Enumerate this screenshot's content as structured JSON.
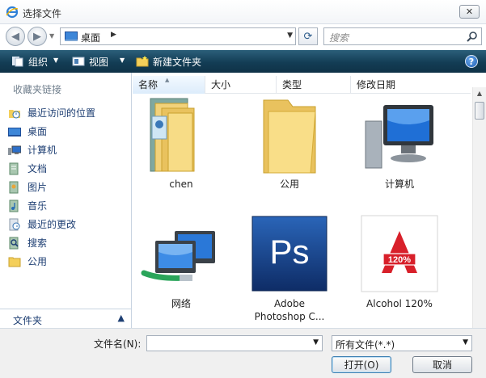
{
  "window": {
    "title": "选择文件"
  },
  "address": {
    "location": "桌面"
  },
  "search": {
    "placeholder": "搜索"
  },
  "toolbar": {
    "organize": "组织",
    "view": "视图",
    "new_folder": "新建文件夹"
  },
  "sidebar": {
    "heading": "收藏夹链接",
    "items": [
      {
        "label": "最近访问的位置",
        "icon": "recent-places-icon"
      },
      {
        "label": "桌面",
        "icon": "desktop-icon"
      },
      {
        "label": "计算机",
        "icon": "computer-icon"
      },
      {
        "label": "文档",
        "icon": "documents-icon"
      },
      {
        "label": "图片",
        "icon": "pictures-icon"
      },
      {
        "label": "音乐",
        "icon": "music-icon"
      },
      {
        "label": "最近的更改",
        "icon": "recent-changes-icon"
      },
      {
        "label": "搜索",
        "icon": "searches-icon"
      },
      {
        "label": "公用",
        "icon": "public-folder-icon"
      }
    ],
    "folders_label": "文件夹"
  },
  "columns": [
    "名称",
    "大小",
    "类型",
    "修改日期"
  ],
  "files": [
    {
      "name": "chen",
      "icon": "user-folder-icon"
    },
    {
      "name": "公用",
      "icon": "folder-icon"
    },
    {
      "name": "计算机",
      "icon": "computer-icon"
    },
    {
      "name": "网络",
      "icon": "network-icon"
    },
    {
      "name": "Adobe Photoshop C...",
      "name_line1": "Adobe",
      "name_line2": "Photoshop C...",
      "icon": "photoshop-icon",
      "icon_text": "Ps"
    },
    {
      "name": "Alcohol 120%",
      "icon": "alcohol-icon",
      "icon_text": "120%"
    }
  ],
  "footer": {
    "filename_label": "文件名(N):",
    "filename_value": "",
    "filetype": "所有文件(*.*)",
    "open_label": "打开(O)",
    "cancel_label": "取消"
  },
  "colors": {
    "toolbar": "#133d55",
    "link": "#1e3f73",
    "accent": "#3c7fb1"
  }
}
